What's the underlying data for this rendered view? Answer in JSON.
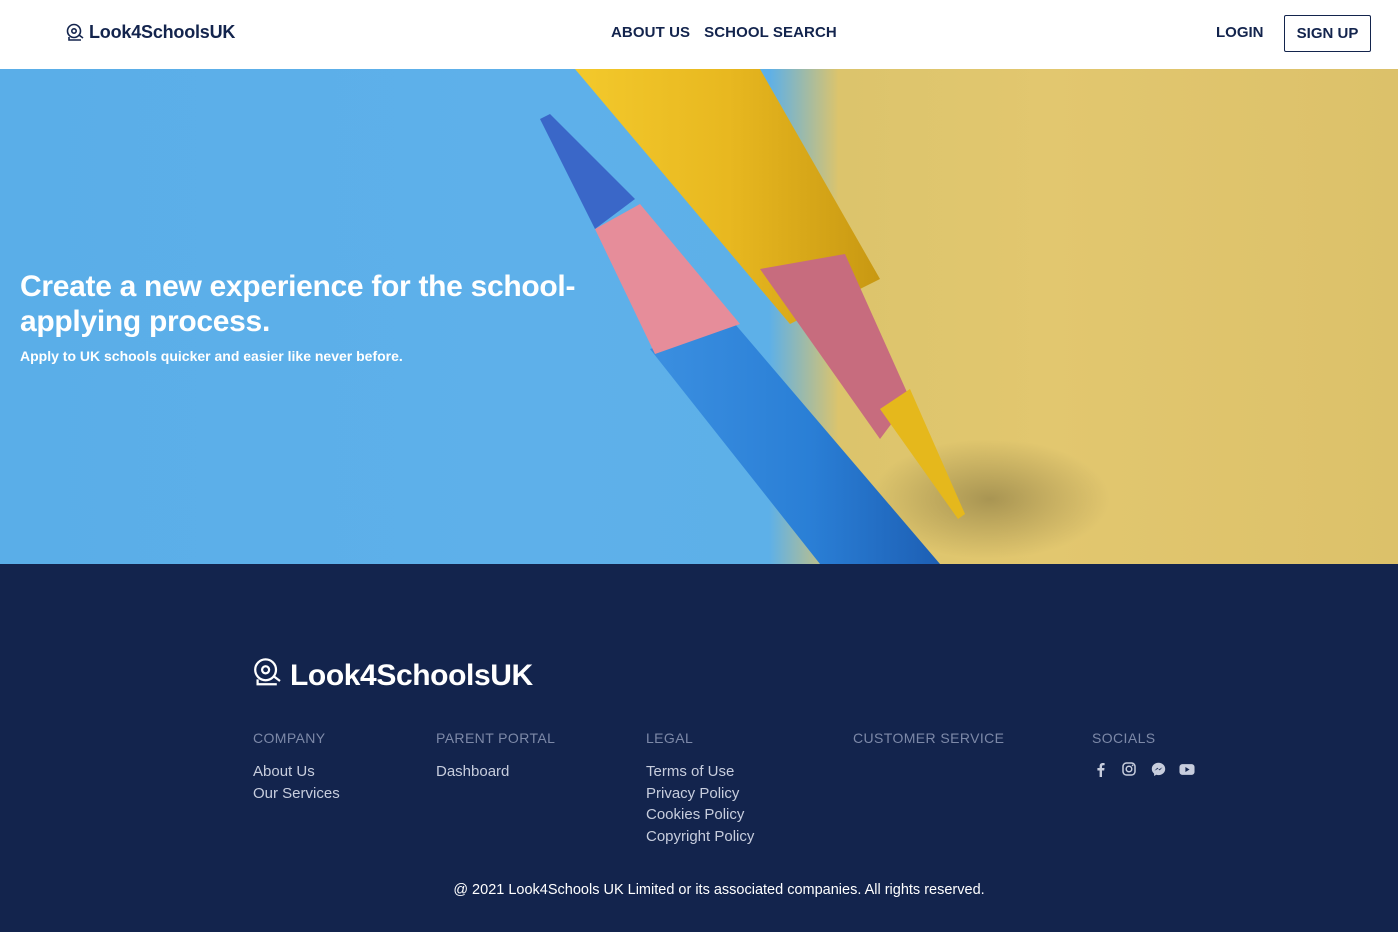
{
  "header": {
    "brand": "Look4SchoolsUK",
    "nav": [
      {
        "label": "ABOUT US"
      },
      {
        "label": "SCHOOL SEARCH"
      }
    ],
    "login_label": "LOGIN",
    "signup_label": "SIGN UP"
  },
  "hero": {
    "title": "Create a new experience for the school-applying process.",
    "subtitle": "Apply to UK schools quicker and easier like never before.",
    "image": "blue-and-yellow-colored-pencils"
  },
  "footer": {
    "brand": "Look4SchoolsUK",
    "columns": [
      {
        "heading": "COMPANY",
        "links": [
          "About Us",
          "Our Services"
        ]
      },
      {
        "heading": "PARENT PORTAL",
        "links": [
          "Dashboard"
        ]
      },
      {
        "heading": "LEGAL",
        "links": [
          "Terms of Use",
          "Privacy Policy",
          "Cookies Policy",
          "Copyright Policy"
        ]
      },
      {
        "heading": "CUSTOMER SERVICE",
        "links": []
      },
      {
        "heading": "SOCIALS",
        "icons": [
          "facebook-icon",
          "instagram-icon",
          "messenger-icon",
          "youtube-icon"
        ]
      }
    ],
    "copyright": "@ 2021 Look4Schools UK Limited or its associated companies. All rights reserved."
  },
  "colors": {
    "navy": "#13244d",
    "hero_blue": "#5eb0ea",
    "hero_yellow": "#e2c76f",
    "footer_muted": "#7d89a8"
  }
}
